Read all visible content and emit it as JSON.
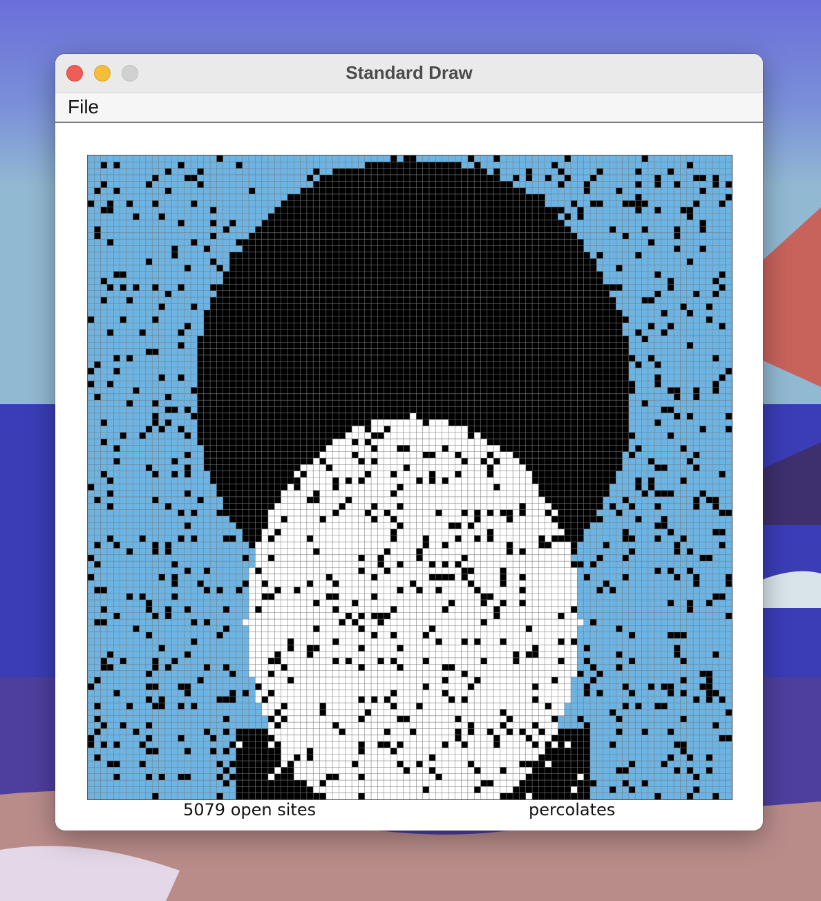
{
  "window": {
    "title": "Standard Draw",
    "menu": [
      "File"
    ]
  },
  "status": {
    "open_sites_text": "5079 open sites",
    "result_text": "percolates"
  },
  "grid": {
    "size": 100,
    "open_sites": 5079,
    "colors": {
      "blocked": "#000000",
      "open": "#ffffff",
      "full": "#6cb4e4",
      "grid_line": "#7a7a7a"
    }
  },
  "desktop": {
    "colors": {
      "sky_top": "#6b74d8",
      "sky_horizon": "#8fb2cf",
      "sea": "#3b3fb8",
      "sand": "#c49a8f"
    }
  }
}
